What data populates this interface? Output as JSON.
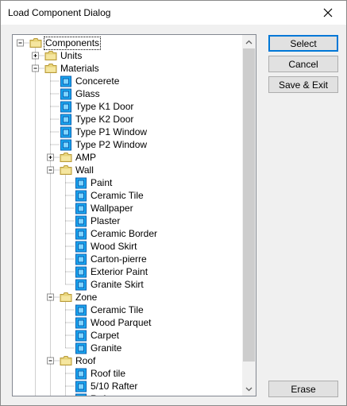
{
  "window": {
    "title": "Load Component Dialog",
    "close_glyph": "✕"
  },
  "buttons": {
    "select": "Select",
    "cancel": "Cancel",
    "save_exit": "Save & Exit",
    "erase": "Erase"
  },
  "colors": {
    "folder": "#e8d47a",
    "folder_dark": "#b89a3a",
    "component": "#1aa7f0",
    "component_dark": "#0a5fb0",
    "focus": "#0078d7"
  },
  "tree": {
    "nodes": [
      {
        "label": "Components",
        "icon": "folder-icon",
        "depth": 0,
        "expander": "minus",
        "selected": true
      },
      {
        "label": "Units",
        "icon": "folder-icon",
        "depth": 1,
        "expander": "plus"
      },
      {
        "label": "Materials",
        "icon": "folder-icon",
        "depth": 1,
        "expander": "minus"
      },
      {
        "label": "Concerete",
        "icon": "component-icon",
        "depth": 2
      },
      {
        "label": "Glass",
        "icon": "component-icon",
        "depth": 2
      },
      {
        "label": "Type K1 Door",
        "icon": "component-icon",
        "depth": 2
      },
      {
        "label": "Type K2 Door",
        "icon": "component-icon",
        "depth": 2
      },
      {
        "label": "Type P1 Window",
        "icon": "component-icon",
        "depth": 2
      },
      {
        "label": "Type P2 Window",
        "icon": "component-icon",
        "depth": 2
      },
      {
        "label": "AMP",
        "icon": "folder-icon",
        "depth": 2,
        "expander": "plus"
      },
      {
        "label": "Wall",
        "icon": "folder-icon",
        "depth": 2,
        "expander": "minus"
      },
      {
        "label": "Paint",
        "icon": "component-icon",
        "depth": 3
      },
      {
        "label": "Ceramic Tile",
        "icon": "component-icon",
        "depth": 3
      },
      {
        "label": "Wallpaper",
        "icon": "component-icon",
        "depth": 3
      },
      {
        "label": "Plaster",
        "icon": "component-icon",
        "depth": 3
      },
      {
        "label": "Ceramic Border",
        "icon": "component-icon",
        "depth": 3
      },
      {
        "label": "Wood Skirt",
        "icon": "component-icon",
        "depth": 3
      },
      {
        "label": "Carton-pierre",
        "icon": "component-icon",
        "depth": 3
      },
      {
        "label": "Exterior Paint",
        "icon": "component-icon",
        "depth": 3
      },
      {
        "label": "Granite Skirt",
        "icon": "component-icon",
        "depth": 3
      },
      {
        "label": "Zone",
        "icon": "folder-icon",
        "depth": 2,
        "expander": "minus"
      },
      {
        "label": "Ceramic Tile",
        "icon": "component-icon",
        "depth": 3
      },
      {
        "label": "Wood Parquet",
        "icon": "component-icon",
        "depth": 3
      },
      {
        "label": "Carpet",
        "icon": "component-icon",
        "depth": 3
      },
      {
        "label": "Granite",
        "icon": "component-icon",
        "depth": 3
      },
      {
        "label": "Roof",
        "icon": "folder-icon",
        "depth": 2,
        "expander": "minus"
      },
      {
        "label": "Roof tile",
        "icon": "component-icon",
        "depth": 3
      },
      {
        "label": "5/10 Rafter",
        "icon": "component-icon",
        "depth": 3
      },
      {
        "label": "Rafter",
        "icon": "component-icon",
        "depth": 3
      }
    ]
  }
}
